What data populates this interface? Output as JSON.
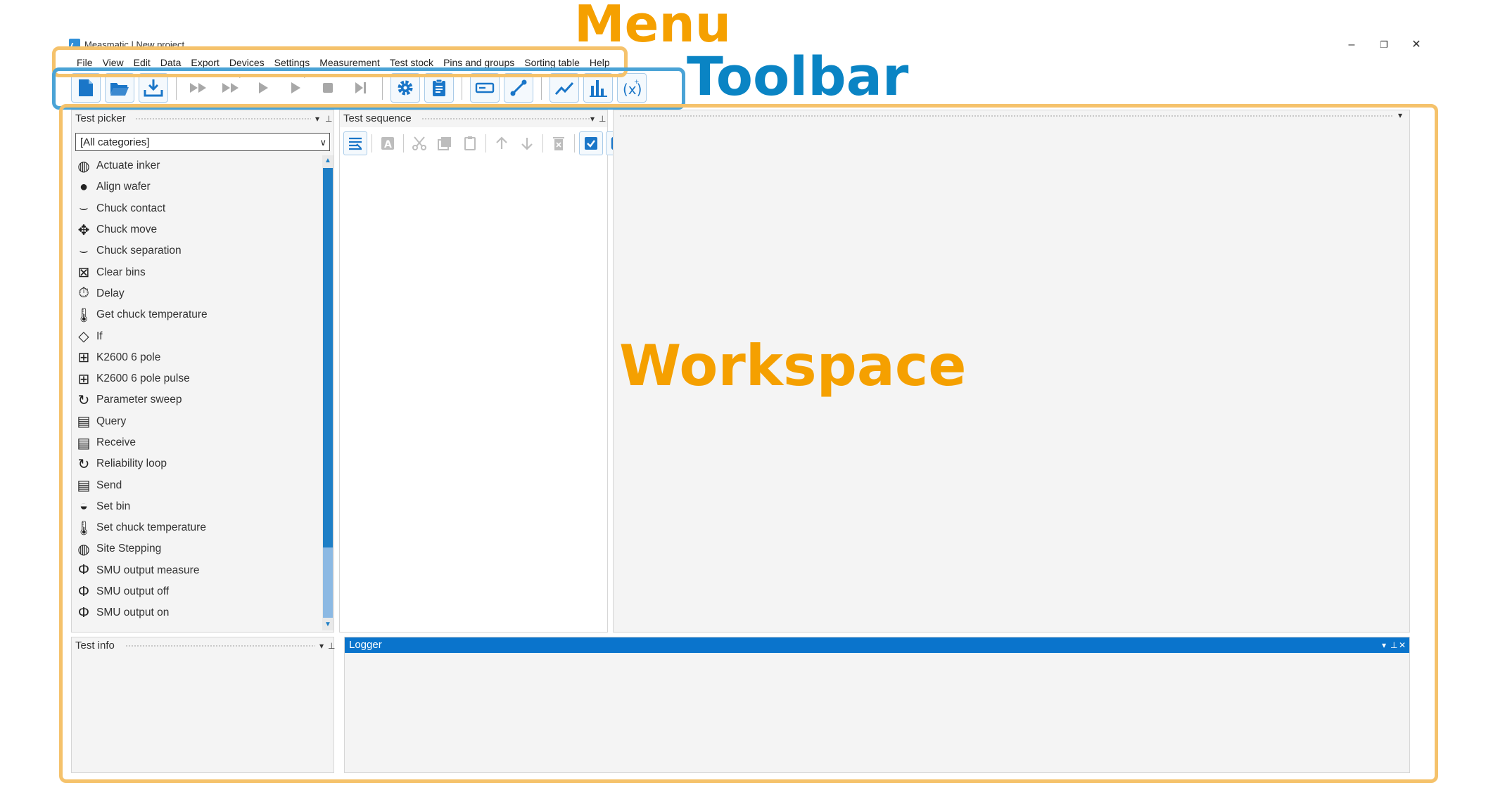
{
  "window": {
    "title": "Measmatic | New project",
    "controls": {
      "minimize": "–",
      "restore": "❐",
      "close": "✕"
    }
  },
  "menu": [
    "File",
    "View",
    "Edit",
    "Data",
    "Export",
    "Devices",
    "Settings",
    "Measurement",
    "Test stock",
    "Pins and groups",
    "Sorting table",
    "Help"
  ],
  "annotations": {
    "menu": "Menu",
    "toolbar": "Toolbar",
    "workspace": "Workspace",
    "colors": {
      "orange": "#f5a000",
      "blue": "#0a84c4",
      "box_orange": "#f5c26b",
      "box_blue": "#4aa3d6"
    }
  },
  "test_picker": {
    "title": "Test picker",
    "category": "[All categories]",
    "items": [
      {
        "label": "Actuate inker",
        "icon": "inker-icon"
      },
      {
        "label": "Align wafer",
        "icon": "wafer-icon"
      },
      {
        "label": "Chuck contact",
        "icon": "chuck-contact-icon"
      },
      {
        "label": "Chuck move",
        "icon": "move-arrows-icon"
      },
      {
        "label": "Chuck separation",
        "icon": "chuck-separation-icon"
      },
      {
        "label": "Clear bins",
        "icon": "clear-bins-icon"
      },
      {
        "label": "Delay",
        "icon": "stopwatch-icon"
      },
      {
        "label": "Get chuck temperature",
        "icon": "thermometer-icon"
      },
      {
        "label": "If",
        "icon": "diamond-question-icon"
      },
      {
        "label": "K2600 6 pole",
        "icon": "k2600-icon"
      },
      {
        "label": "K2600 6 pole pulse",
        "icon": "k2600-pulse-icon"
      },
      {
        "label": "Parameter sweep",
        "icon": "loop-arrow-icon"
      },
      {
        "label": "Query",
        "icon": "instrument-icon"
      },
      {
        "label": "Receive",
        "icon": "instrument-icon"
      },
      {
        "label": "Reliability loop",
        "icon": "loop-arrow-icon"
      },
      {
        "label": "Send",
        "icon": "instrument-icon"
      },
      {
        "label": "Set bin",
        "icon": "set-bin-icon"
      },
      {
        "label": "Set chuck temperature",
        "icon": "thermometer-icon"
      },
      {
        "label": "Site Stepping",
        "icon": "wafer-grid-icon"
      },
      {
        "label": "SMU output measure",
        "icon": "smu-icon"
      },
      {
        "label": "SMU output off",
        "icon": "smu-icon"
      },
      {
        "label": "SMU output on",
        "icon": "smu-icon"
      }
    ]
  },
  "test_sequence": {
    "title": "Test sequence"
  },
  "test_info": {
    "title": "Test info"
  },
  "logger": {
    "title": "Logger"
  }
}
